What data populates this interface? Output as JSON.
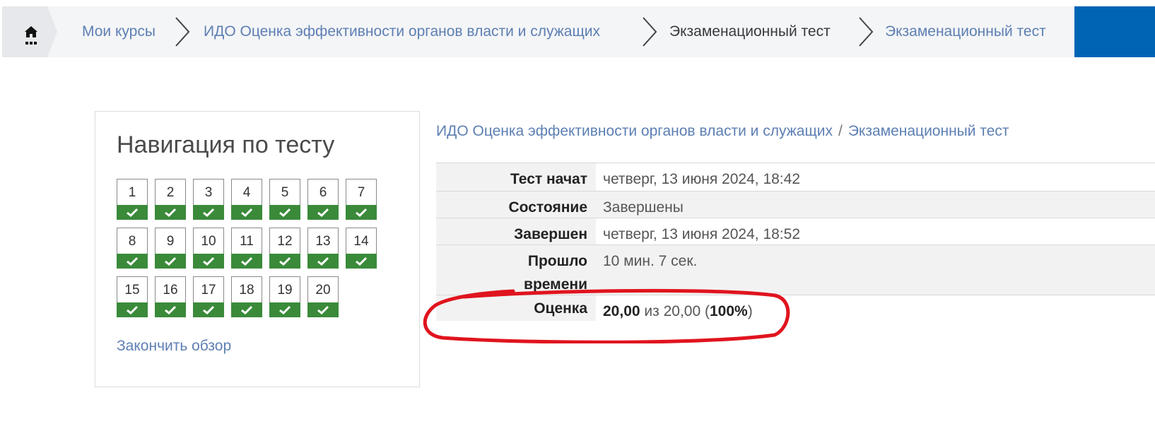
{
  "breadcrumb": {
    "home_icon": "home-icon",
    "items": [
      {
        "label": "Мои курсы",
        "link": true
      },
      {
        "label": "ИДО Оценка эффективности органов власти и служащих",
        "link": true
      },
      {
        "label": "Экзаменационный тест",
        "link": false
      },
      {
        "label": "Экзаменационный тест",
        "link": true
      }
    ]
  },
  "navigation": {
    "title": "Навигация по тесту",
    "questions": [
      "1",
      "2",
      "3",
      "4",
      "5",
      "6",
      "7",
      "8",
      "9",
      "10",
      "11",
      "12",
      "13",
      "14",
      "15",
      "16",
      "17",
      "18",
      "19",
      "20"
    ],
    "question_state": "correct",
    "state_color": "#3a8a3a",
    "finish_label": "Закончить обзор"
  },
  "summary": {
    "course_link": "ИДО Оценка эффективности органов власти и служащих",
    "separator": "/",
    "quiz_link": "Экзаменационный тест",
    "rows": [
      {
        "label": "Тест начат",
        "value": "четверг, 13 июня 2024, 18:42"
      },
      {
        "label": "Состояние",
        "value": "Завершены"
      },
      {
        "label": "Завершен",
        "value": "четверг, 13 июня 2024, 18:52"
      },
      {
        "label": "Прошло времени",
        "value": "10 мин. 7 сек."
      }
    ],
    "grade": {
      "label": "Оценка",
      "score": "20,00",
      "of_text": "из 20,00",
      "percent": "100%"
    }
  },
  "colors": {
    "accent_link": "#5d7fb3",
    "corner_block": "#0064b4",
    "highlight_ring": "#e0141e"
  }
}
